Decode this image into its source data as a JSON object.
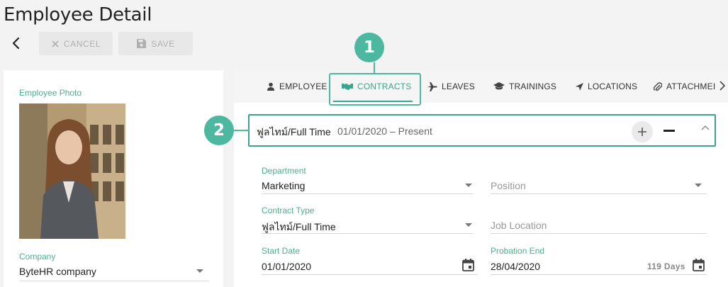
{
  "page_title": "Employee Detail",
  "toolbar": {
    "cancel_label": "CANCEL",
    "save_label": "SAVE"
  },
  "left": {
    "photo_label": "Employee Photo",
    "company_label": "Company",
    "company_value": "ByteHR company"
  },
  "tabs": [
    {
      "label": "EMPLOYEE",
      "icon": "person-icon"
    },
    {
      "label": "CONTRACTS",
      "icon": "handshake-icon"
    },
    {
      "label": "LEAVES",
      "icon": "airplane-icon"
    },
    {
      "label": "TRAININGS",
      "icon": "graduation-cap-icon"
    },
    {
      "label": "LOCATIONS",
      "icon": "location-arrow-icon"
    },
    {
      "label": "ATTACHMEI",
      "icon": "paperclip-icon"
    }
  ],
  "contract": {
    "type": "ฟูลไทม์/Full Time",
    "range": "01/01/2020 – Present"
  },
  "form": {
    "department": {
      "label": "Department",
      "value": "Marketing"
    },
    "position": {
      "placeholder": "Position"
    },
    "contract_type": {
      "label": "Contract Type",
      "value": "ฟูลไทม์/Full Time"
    },
    "job_location": {
      "placeholder": "Job Location"
    },
    "start_date": {
      "label": "Start Date",
      "value": "01/01/2020"
    },
    "probation_end": {
      "label": "Probation End",
      "value": "28/04/2020",
      "days": "119 Days"
    }
  },
  "markers": [
    "1",
    "2"
  ],
  "colors": {
    "accent": "#3aa58c",
    "marker": "#4db8a0"
  }
}
